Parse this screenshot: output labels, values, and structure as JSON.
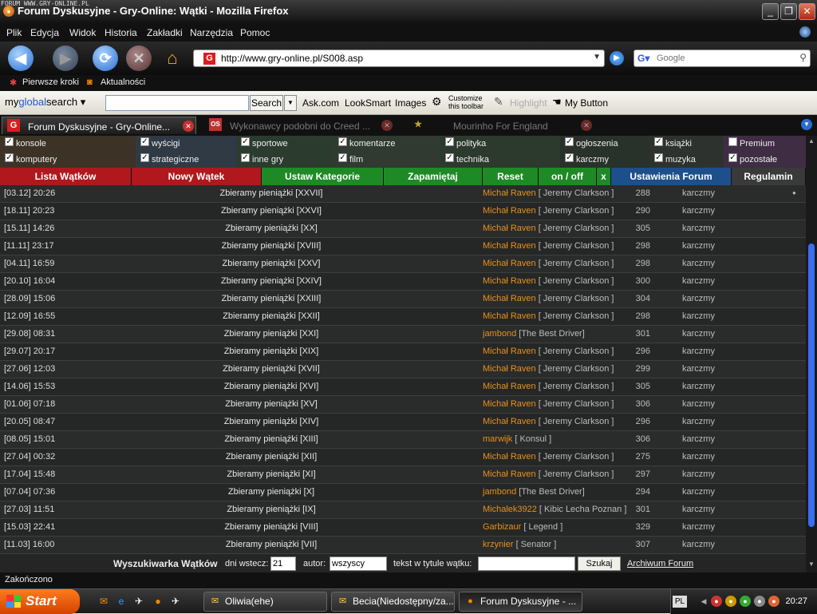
{
  "window": {
    "tag": "FORUM WWW.GRY-ONLINE.PL",
    "title": "Forum Dyskusyjne - Gry-Online: Wątki - Mozilla Firefox"
  },
  "menu": [
    "Plik",
    "Edycja",
    "Widok",
    "Historia",
    "Zakładki",
    "Narzędzia",
    "Pomoc"
  ],
  "nav": {
    "url": "http://www.gry-online.pl/S008.asp",
    "search_placeholder": "Google"
  },
  "bookmarks": [
    "Pierwsze kroki",
    "Aktualności"
  ],
  "toolbar": {
    "logo_a": "my",
    "logo_b": "global",
    "logo_c": "search",
    "search_button": "Search",
    "links": [
      "Ask.com",
      "LookSmart",
      "Images"
    ],
    "customize_1": "Customize",
    "customize_2": "this toolbar",
    "highlight": "Highlight",
    "my_button": "My Button"
  },
  "tabs": [
    {
      "label": "Forum Dyskusyjne - Gry-Online..."
    },
    {
      "label": "Wykonawcy podobni do Creed ..."
    },
    {
      "label": "Mourinho For England"
    }
  ],
  "filters": [
    {
      "label": "konsole",
      "checked": true
    },
    {
      "label": "wyścigi",
      "checked": true
    },
    {
      "label": "sportowe",
      "checked": true
    },
    {
      "label": "komentarze",
      "checked": true
    },
    {
      "label": "polityka",
      "checked": true
    },
    {
      "label": "ogłoszenia",
      "checked": true
    },
    {
      "label": "książki",
      "checked": true
    },
    {
      "label": "Premium",
      "checked": false
    },
    {
      "label": "komputery",
      "checked": true
    },
    {
      "label": "strategiczne",
      "checked": true
    },
    {
      "label": "inne gry",
      "checked": true
    },
    {
      "label": "film",
      "checked": true
    },
    {
      "label": "technika",
      "checked": true
    },
    {
      "label": "karczmy",
      "checked": true
    },
    {
      "label": "muzyka",
      "checked": true
    },
    {
      "label": "pozostałe",
      "checked": true
    }
  ],
  "forum_bar": {
    "lista": "Lista Wątków",
    "nowy": "Nowy Wątek",
    "ustaw": "Ustaw Kategorie",
    "zapamietaj": "Zapamiętaj",
    "reset": "Reset",
    "onoff": "on / off",
    "x": "x",
    "ustawienia": "Ustawienia Forum",
    "regulamin": "Regulamin"
  },
  "threads": [
    {
      "date": "[03.12] 20:26",
      "title": "Zbieramy pieniążki [XXVII]",
      "author": "Michał Raven",
      "rank": " [ Jeremy Clarkson ]",
      "count": "288",
      "forum": "karczmy",
      "dot": "●"
    },
    {
      "date": "[18.11] 20:23",
      "title": "Zbieramy pieniążki [XXVI]",
      "author": "Michał Raven",
      "rank": " [ Jeremy Clarkson ]",
      "count": "290",
      "forum": "karczmy",
      "dot": ""
    },
    {
      "date": "[15.11] 14:26",
      "title": "Zbieramy pieniążki [XX]",
      "author": "Michał Raven",
      "rank": " [ Jeremy Clarkson ]",
      "count": "305",
      "forum": "karczmy",
      "dot": ""
    },
    {
      "date": "[11.11] 23:17",
      "title": "Zbieramy pieniążki [XVIII]",
      "author": "Michał Raven",
      "rank": " [ Jeremy Clarkson ]",
      "count": "298",
      "forum": "karczmy",
      "dot": ""
    },
    {
      "date": "[04.11] 16:59",
      "title": "Zbieramy pieniążki [XXV]",
      "author": "Michał Raven",
      "rank": " [ Jeremy Clarkson ]",
      "count": "298",
      "forum": "karczmy",
      "dot": ""
    },
    {
      "date": "[20.10] 16:04",
      "title": "Zbieramy pieniążki [XXIV]",
      "author": "Michał Raven",
      "rank": " [ Jeremy Clarkson ]",
      "count": "300",
      "forum": "karczmy",
      "dot": ""
    },
    {
      "date": "[28.09] 15:06",
      "title": "Zbieramy pieniążki [XXIII]",
      "author": "Michał Raven",
      "rank": " [ Jeremy Clarkson ]",
      "count": "304",
      "forum": "karczmy",
      "dot": ""
    },
    {
      "date": "[12.09] 16:55",
      "title": "Zbieramy pieniążki [XXII]",
      "author": "Michał Raven",
      "rank": " [ Jeremy Clarkson ]",
      "count": "298",
      "forum": "karczmy",
      "dot": ""
    },
    {
      "date": "[29.08] 08:31",
      "title": "Zbieramy pieniążki [XXI]",
      "author": "jambond",
      "rank": " [The Best Driver]",
      "count": "301",
      "forum": "karczmy",
      "dot": ""
    },
    {
      "date": "[29.07] 20:17",
      "title": "Zbieramy pieniążki [XIX]",
      "author": "Michał Raven",
      "rank": " [ Jeremy Clarkson ]",
      "count": "296",
      "forum": "karczmy",
      "dot": ""
    },
    {
      "date": "[27.06] 12:03",
      "title": "Zbieramy pieniążki [XVII]",
      "author": "Michał Raven",
      "rank": " [ Jeremy Clarkson ]",
      "count": "299",
      "forum": "karczmy",
      "dot": ""
    },
    {
      "date": "[14.06] 15:53",
      "title": "Zbieramy pieniążki [XVI]",
      "author": "Michał Raven",
      "rank": " [ Jeremy Clarkson ]",
      "count": "305",
      "forum": "karczmy",
      "dot": ""
    },
    {
      "date": "[01.06] 07:18",
      "title": "Zbieramy pieniążki [XV]",
      "author": "Michał Raven",
      "rank": " [ Jeremy Clarkson ]",
      "count": "306",
      "forum": "karczmy",
      "dot": ""
    },
    {
      "date": "[20.05] 08:47",
      "title": "Zbieramy pieniążki [XIV]",
      "author": "Michał Raven",
      "rank": " [ Jeremy Clarkson ]",
      "count": "296",
      "forum": "karczmy",
      "dot": ""
    },
    {
      "date": "[08.05] 15:01",
      "title": "Zbieramy pieniążki [XIII]",
      "author": "marwijk",
      "rank": " [ Konsul ]",
      "count": "306",
      "forum": "karczmy",
      "dot": ""
    },
    {
      "date": "[27.04] 00:32",
      "title": "Zbieramy pieniążki [XII]",
      "author": "Michał Raven",
      "rank": " [ Jeremy Clarkson ]",
      "count": "275",
      "forum": "karczmy",
      "dot": ""
    },
    {
      "date": "[17.04] 15:48",
      "title": "Zbieramy pieniążki [XI]",
      "author": "Michał Raven",
      "rank": " [ Jeremy Clarkson ]",
      "count": "297",
      "forum": "karczmy",
      "dot": ""
    },
    {
      "date": "[07.04] 07:36",
      "title": "Zbieramy pieniążki [X]",
      "author": "jambond",
      "rank": " [The Best Driver]",
      "count": "294",
      "forum": "karczmy",
      "dot": ""
    },
    {
      "date": "[27.03] 11:51",
      "title": "Zbieramy pieniążki [IX]",
      "author": "Michalek3922",
      "rank": " [ Kibic Lecha Poznan ]",
      "count": "301",
      "forum": "karczmy",
      "dot": ""
    },
    {
      "date": "[15.03] 22:41",
      "title": "Zbieramy pieniążki [VIII]",
      "author": "Garbizaur",
      "rank": " [ Legend ]",
      "count": "329",
      "forum": "karczmy",
      "dot": ""
    },
    {
      "date": "[11.03] 16:00",
      "title": "Zbieramy pieniążki [VII]",
      "author": "krzynier",
      "rank": " [ Senator ]",
      "count": "307",
      "forum": "karczmy",
      "dot": ""
    }
  ],
  "search": {
    "label": "Wyszukiwarka Wątków",
    "days_label": "dni wstecz:",
    "days_value": "21",
    "author_label": "autor:",
    "author_value": "wszyscy",
    "title_label": "tekst w tytule wątku:",
    "title_value": "",
    "button": "Szukaj",
    "archive": "Archiwum Forum"
  },
  "status": "Zakończono",
  "taskbar": {
    "start": "Start",
    "tasks": [
      "Oliwia(ehe)",
      "Becia(Niedostępny/za...",
      "Forum Dyskusyjne - ..."
    ],
    "lang": "PL",
    "clock": "20:27"
  }
}
